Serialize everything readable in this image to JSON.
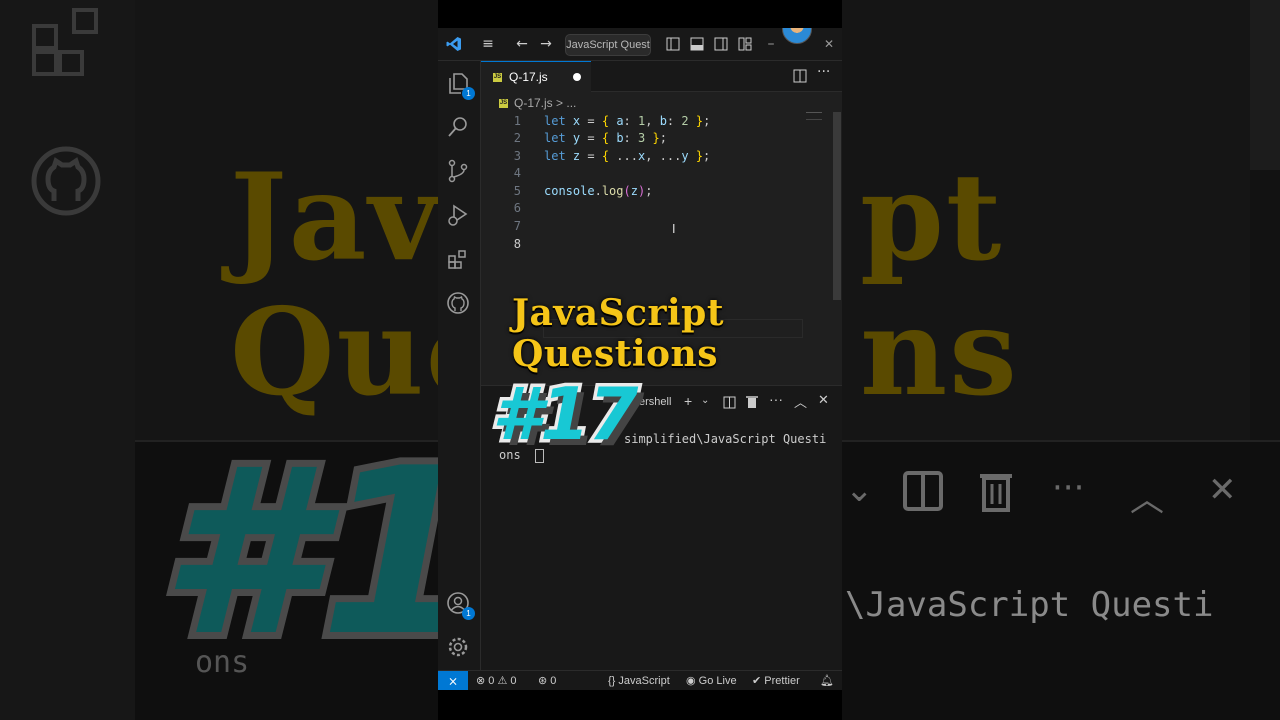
{
  "window": {
    "command_center": "JavaScript Quest",
    "title_icons": [
      "menu-icon",
      "back-arrow-icon",
      "forward-arrow-icon",
      "layout-icons",
      "minimize-icon",
      "maximize-icon",
      "close-icon"
    ]
  },
  "activity_bar": {
    "explorer_badge": "1",
    "accounts_badge": "1"
  },
  "editor": {
    "tab_label": "Q-17.js",
    "tab_icon": "JS",
    "breadcrumb_file": "Q-17.js",
    "breadcrumb_sep": ">",
    "breadcrumb_more": "...",
    "line_numbers": [
      "1",
      "2",
      "3",
      "4",
      "5",
      "6",
      "7",
      "8"
    ],
    "lines": [
      "let x = { a: 1, b: 2 };",
      "let y = { b: 3 };",
      "let z = { ...x, ...y };",
      "",
      "console.log(z);",
      "",
      "",
      ""
    ]
  },
  "overlay": {
    "title_line1": "JavaScript",
    "title_line2": "Questions",
    "number": "#17"
  },
  "panel": {
    "shell_label": "ershell",
    "terminal_line1": "simplified\\JavaScript Questi",
    "terminal_line2": "ons"
  },
  "status_bar": {
    "errors": "0",
    "warnings": "0",
    "ports": "0",
    "language": "JavaScript",
    "go_live": "Go Live",
    "prettier": "Prettier"
  },
  "background": {
    "title_line1": "Jav",
    "title_line2": "Que",
    "title_right1": "pt",
    "title_right2": "ns",
    "badge": "#1",
    "terminal_text": "\\JavaScript Questi",
    "terminal_ons": "ons"
  },
  "colors": {
    "accent": "#0078d4",
    "title_yellow": "#f5c518",
    "badge_cyan": "#18c8d4",
    "editor_bg": "#1f1f1f"
  }
}
